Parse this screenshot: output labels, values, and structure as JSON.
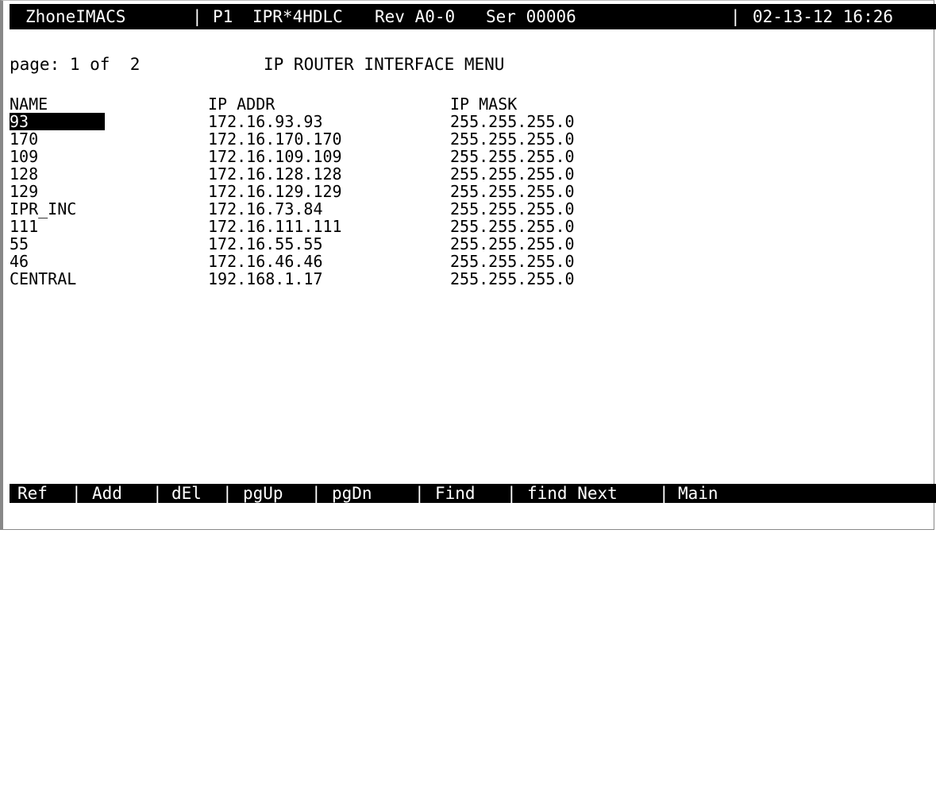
{
  "status_bar": {
    "app": "ZhoneIMACS",
    "slot": "P1",
    "card": "IPR*4HDLC",
    "rev": "Rev A0-0",
    "ser": "Ser 00006",
    "datetime": "02-13-12 16:26"
  },
  "page_indicator": "page: 1 of  2",
  "menu_title": "IP ROUTER INTERFACE MENU",
  "table": {
    "headers": [
      "NAME",
      "IP ADDR",
      "IP MASK"
    ],
    "selected_row": 0,
    "rows": [
      {
        "name": "93",
        "ip": "172.16.93.93",
        "mask": "255.255.255.0"
      },
      {
        "name": "170",
        "ip": "172.16.170.170",
        "mask": "255.255.255.0"
      },
      {
        "name": "109",
        "ip": "172.16.109.109",
        "mask": "255.255.255.0"
      },
      {
        "name": "128",
        "ip": "172.16.128.128",
        "mask": "255.255.255.0"
      },
      {
        "name": "129",
        "ip": "172.16.129.129",
        "mask": "255.255.255.0"
      },
      {
        "name": "IPR_INC",
        "ip": "172.16.73.84",
        "mask": "255.255.255.0"
      },
      {
        "name": "111",
        "ip": "172.16.111.111",
        "mask": "255.255.255.0"
      },
      {
        "name": "55",
        "ip": "172.16.55.55",
        "mask": "255.255.255.0"
      },
      {
        "name": "46",
        "ip": "172.16.46.46",
        "mask": "255.255.255.0"
      },
      {
        "name": "CENTRAL",
        "ip": "192.168.1.17",
        "mask": "255.255.255.0"
      }
    ]
  },
  "menu_bar": {
    "items": [
      "Ref",
      "Add",
      "dEl",
      "pgUp",
      "pgDn",
      "Find",
      "find Next",
      "Main"
    ],
    "separator": "|"
  }
}
